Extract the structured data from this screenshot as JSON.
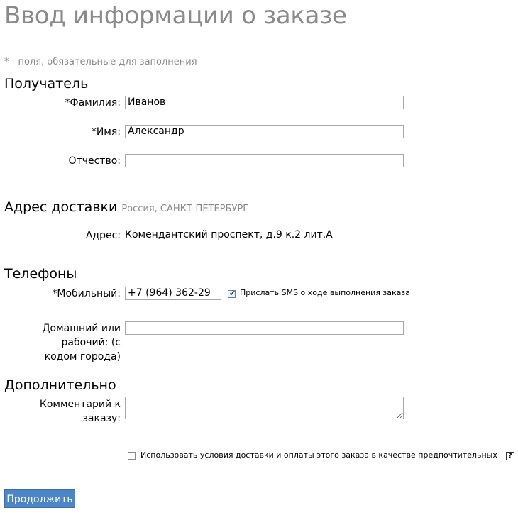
{
  "page": {
    "title": "Ввод информации о заказе",
    "required_note": "* - поля, обязательные для заполнения"
  },
  "recipient": {
    "heading": "Получатель",
    "last_name_label": "*Фамилия:",
    "last_name_value": "Иванов",
    "first_name_label": "*Имя:",
    "first_name_value": "Александр",
    "patronymic_label": "Отчество:",
    "patronymic_value": ""
  },
  "delivery": {
    "heading": "Адрес доставки",
    "region": "Россия, САНКТ-ПЕТЕРБУРГ",
    "address_label": "Адрес:",
    "address_value": "Комендантский проспект, д.9 к.2 лит.А"
  },
  "phones": {
    "heading": "Телефоны",
    "mobile_label": "*Мобильный:",
    "mobile_value": "+7 (964) 362-29",
    "sms_label": "Прислать SMS о ходе выполнения заказа",
    "sms_checked": true,
    "home_label": "Домашний или рабочий: (с кодом города)",
    "home_value": ""
  },
  "extra": {
    "heading": "Дополнительно",
    "comment_label": "Комментарий к заказу:",
    "comment_value": ""
  },
  "preferences": {
    "label": "Использовать условия доставки и оплаты этого заказа в качестве предпочтительных",
    "checked": false,
    "help_icon": "?"
  },
  "actions": {
    "continue_label": "Продолжить"
  },
  "colors": {
    "accent": "#4d86c7",
    "muted_text": "#8a8a8a"
  }
}
